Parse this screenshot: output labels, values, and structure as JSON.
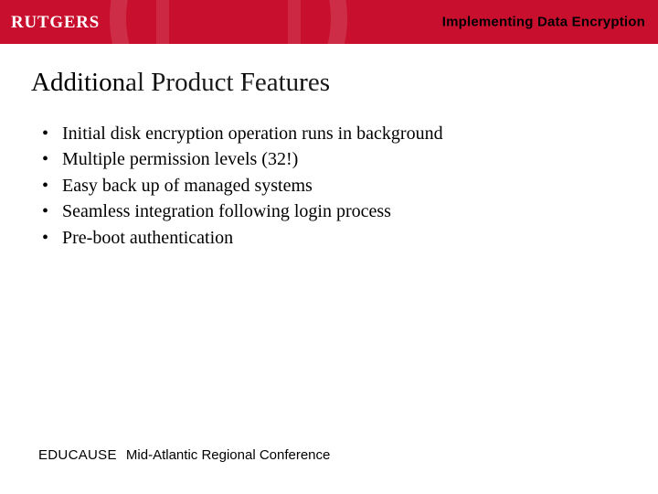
{
  "header": {
    "logo_text": "RUTGERS",
    "title": "Implementing Data Encryption"
  },
  "slide": {
    "title": "Additional Product Features",
    "bullets": [
      "Initial disk encryption operation runs in background",
      "Multiple permission levels (32!)",
      "Easy back up of managed systems",
      "Seamless integration following login process",
      "Pre-boot authentication"
    ]
  },
  "footer": {
    "org": "EDUCAUSE",
    "event": "Mid-Atlantic Regional Conference"
  },
  "colors": {
    "brand_red": "#c8102e"
  }
}
